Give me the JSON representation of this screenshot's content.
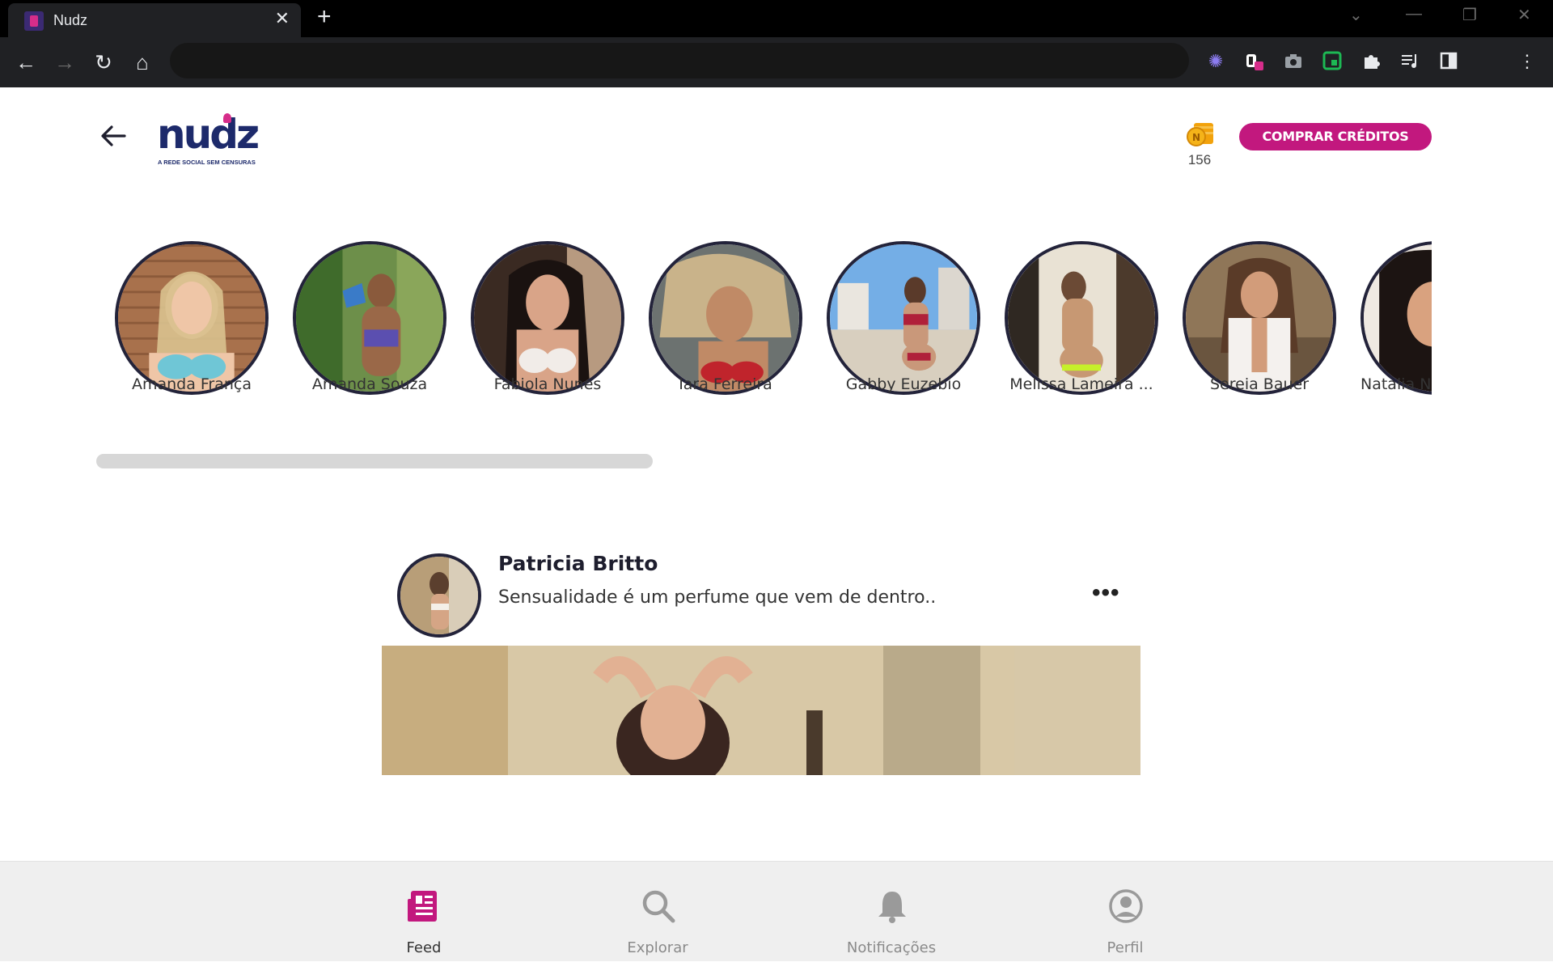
{
  "browser": {
    "tab_title": "Nudz",
    "tab_close": "✕",
    "new_tab": "+"
  },
  "header": {
    "logo_text": "nudz",
    "logo_tagline": "A REDE SOCIAL SEM CENSURAS",
    "credits": "156",
    "buy_button": "COMPRAR CRÉDITOS"
  },
  "stories": [
    {
      "name": "Amanda França"
    },
    {
      "name": "Amanda Souza"
    },
    {
      "name": "Fabiola Nunes"
    },
    {
      "name": "Iara Ferreira"
    },
    {
      "name": "Gabby Euzebio"
    },
    {
      "name": "Melissa Lameira ..."
    },
    {
      "name": "Sereia Bauer"
    },
    {
      "name": "Natalia N"
    }
  ],
  "post": {
    "author": "Patricia Britto",
    "caption": "Sensualidade é um perfume que vem de dentro..",
    "more": "•••"
  },
  "bottom_nav": {
    "feed": "Feed",
    "explore": "Explorar",
    "notifications": "Notificações",
    "profile": "Perfil"
  },
  "colors": {
    "brand_pink": "#c2187e",
    "brand_navy": "#1d2a6b"
  }
}
